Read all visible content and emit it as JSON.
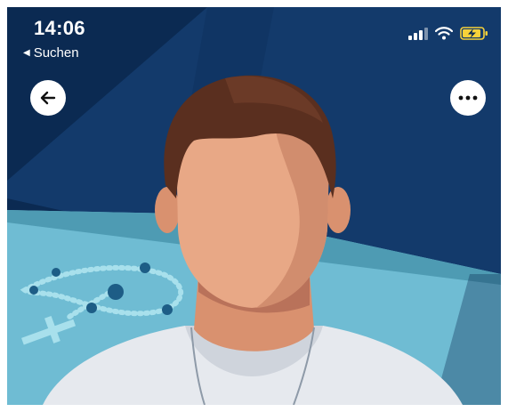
{
  "status_bar": {
    "time": "14:06",
    "back_app_label": "Suchen",
    "back_app_glyph": "◀",
    "icons": [
      "cellular-signal-icon",
      "wifi-icon",
      "battery-charging-icon"
    ]
  },
  "navigation": {
    "back_icon": "arrow-left-icon",
    "more_icon": "more-horizontal-icon"
  },
  "colors": {
    "background_navy": "#0b2a52",
    "table_teal": "#6fbcd3",
    "battery_yellow": "#f7d13a",
    "skin": "#e8a886",
    "hair": "#5a2f1f",
    "shirt": "#e6e9ee"
  }
}
